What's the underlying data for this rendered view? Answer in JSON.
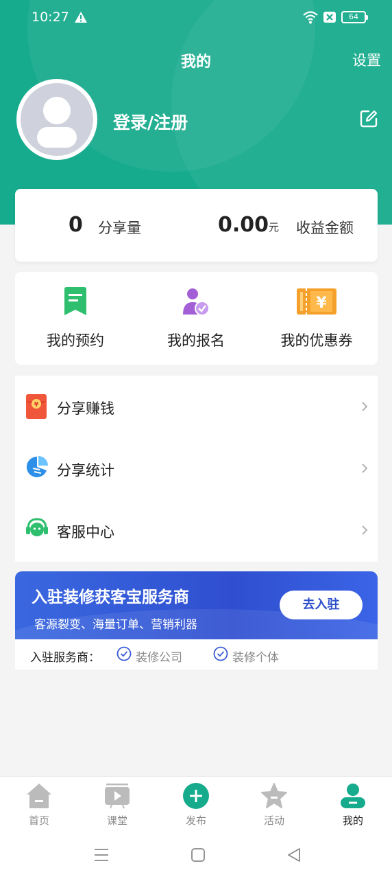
{
  "status_bar": {
    "time": "10:27",
    "battery": "64"
  },
  "header": {
    "title": "我的",
    "settings": "设置",
    "login": "登录/注册"
  },
  "stats": [
    {
      "value": "0",
      "label": "分享量"
    },
    {
      "value": "0.00",
      "unit": "元",
      "label": "收益金额"
    }
  ],
  "quick_actions": [
    {
      "label": "我的预约",
      "icon": "bookmark-icon"
    },
    {
      "label": "我的报名",
      "icon": "user-check-icon"
    },
    {
      "label": "我的优惠券",
      "icon": "coupon-icon"
    }
  ],
  "menu": [
    {
      "label": "分享赚钱",
      "icon": "red-envelope-icon"
    },
    {
      "label": "分享统计",
      "icon": "pie-chart-icon"
    },
    {
      "label": "客服中心",
      "icon": "headset-icon"
    }
  ],
  "banner": {
    "title": "入驻装修获客宝服务商",
    "subtitle": "客源裂变、海量订单、营销利器",
    "button": "去入驻"
  },
  "provider": {
    "label": "入驻服务商：",
    "options": [
      "装修公司",
      "装修个体"
    ]
  },
  "tabs": [
    {
      "label": "首页",
      "icon": "home-icon"
    },
    {
      "label": "课堂",
      "icon": "video-icon"
    },
    {
      "label": "发布",
      "icon": "plus-icon"
    },
    {
      "label": "活动",
      "icon": "star-icon"
    },
    {
      "label": "我的",
      "icon": "person-icon",
      "active": true
    }
  ],
  "colors": {
    "primary": "#17ab8d",
    "banner": "#2f4fd0",
    "background": "#f4f4f4"
  }
}
